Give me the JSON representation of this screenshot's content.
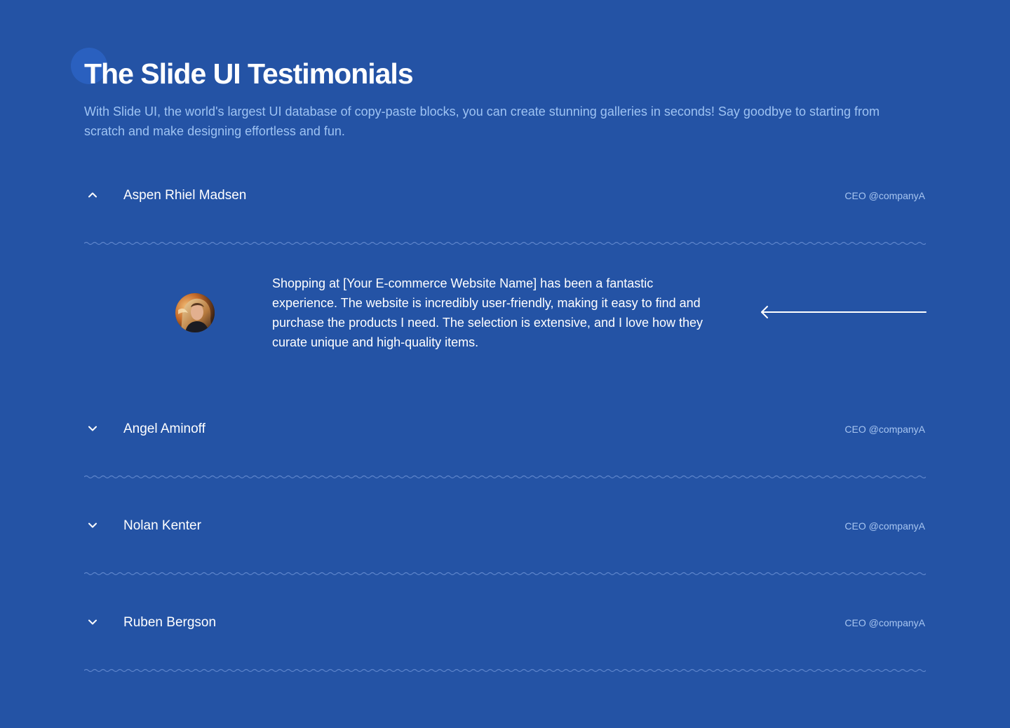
{
  "header": {
    "title": "The Slide UI Testimonials",
    "subtitle": "With Slide UI, the world's largest UI database of copy-paste blocks, you can create stunning galleries in seconds! Say goodbye to starting from scratch and make designing effortless and fun."
  },
  "testimonials": [
    {
      "name": "Aspen Rhiel Madsen",
      "role": "CEO @companyA",
      "expanded": true,
      "chevron_icon": "chevron-up-icon",
      "quote": "Shopping at [Your E-commerce Website Name] has been a fantastic experience. The website is incredibly user-friendly, making it easy to find and purchase the products I need. The selection is extensive, and I love how they curate unique and high-quality items."
    },
    {
      "name": "Angel Aminoff",
      "role": "CEO @companyA",
      "expanded": false,
      "chevron_icon": "chevron-down-icon"
    },
    {
      "name": "Nolan Kenter",
      "role": "CEO @companyA",
      "expanded": false,
      "chevron_icon": "chevron-down-icon"
    },
    {
      "name": "Ruben Bergson",
      "role": "CEO @companyA",
      "expanded": false,
      "chevron_icon": "chevron-down-icon"
    }
  ],
  "controls": {
    "arrow_icon": "arrow-left-icon"
  },
  "colors": {
    "background": "#2453a5",
    "subtitle": "#9ec3f3",
    "role": "#a7c5f0",
    "divider": "#5f86cc",
    "text": "#ffffff"
  }
}
